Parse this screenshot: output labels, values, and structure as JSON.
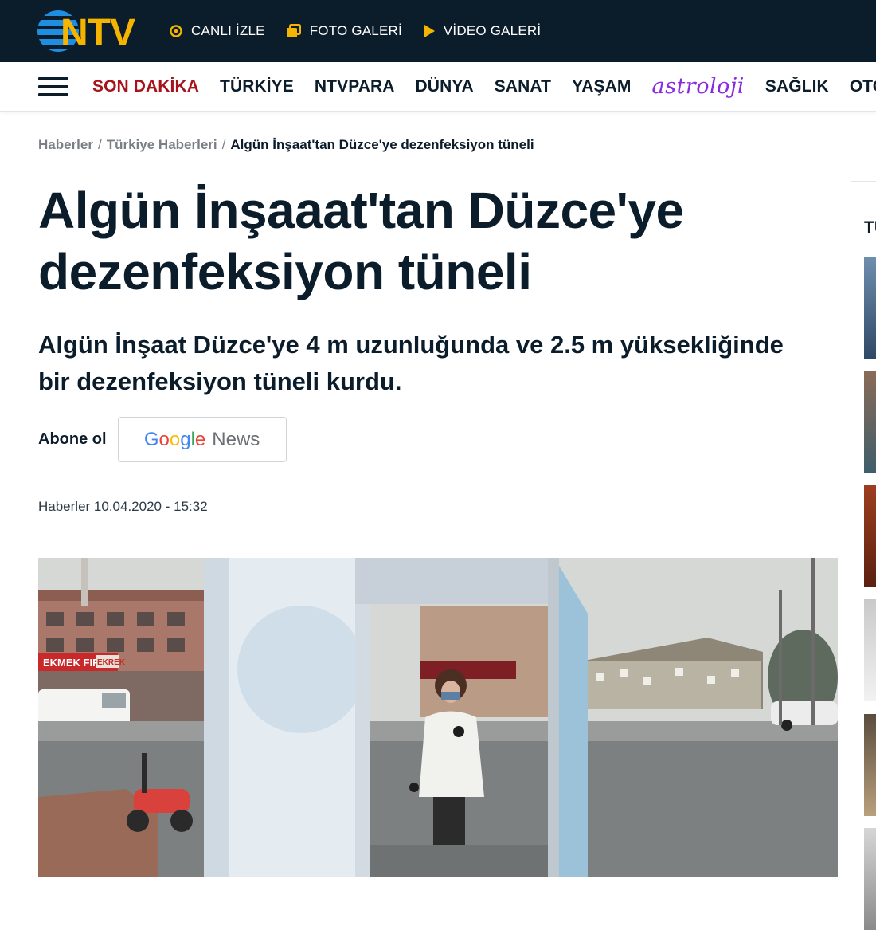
{
  "topbar": {
    "logo_text": "NTV",
    "links": [
      {
        "label": "CANLI İZLE",
        "icon": "live-circle-icon"
      },
      {
        "label": "FOTO GALERİ",
        "icon": "photo-gallery-icon"
      },
      {
        "label": "VİDEO GALERİ",
        "icon": "play-icon"
      }
    ],
    "accent_color": "#f5b400"
  },
  "nav": {
    "items": [
      "SON DAKİKA",
      "TÜRKİYE",
      "NTVPARA",
      "DÜNYA",
      "SANAT",
      "YAŞAM",
      "astroloji",
      "SAĞLIK",
      "OTOMOBİL"
    ],
    "breaking_color": "#a8131b"
  },
  "breadcrumb": {
    "items": [
      "Haberler",
      "Türkiye Haberleri"
    ],
    "current": "Algün İnşaat'tan Düzce'ye dezenfeksiyon tüneli",
    "separator": "/"
  },
  "article": {
    "title_line1": "Algün İnşaaat'tan Düzce'ye",
    "title_line2": "dezenfeksiyon tüneli",
    "summary_line1": "Algün İnşaat Düzce'ye 4 m uzunluğunda ve 2.5 m yüksekliğinde",
    "summary_line2": "bir dezenfeksiyon tüneli kurdu.",
    "subscribe_label": "Abone ol",
    "google_news": {
      "g": "G",
      "o1": "o",
      "o2": "o",
      "g2": "g",
      "l": "l",
      "e": "e",
      "word": "News"
    },
    "meta": "Haberler 10.04.2020 - 15:32",
    "photo_signs": {
      "left_shop": "EKMEK FIRI",
      "left_shop2": "EKREK"
    }
  },
  "sidebar": {
    "heading": "TÜ"
  }
}
